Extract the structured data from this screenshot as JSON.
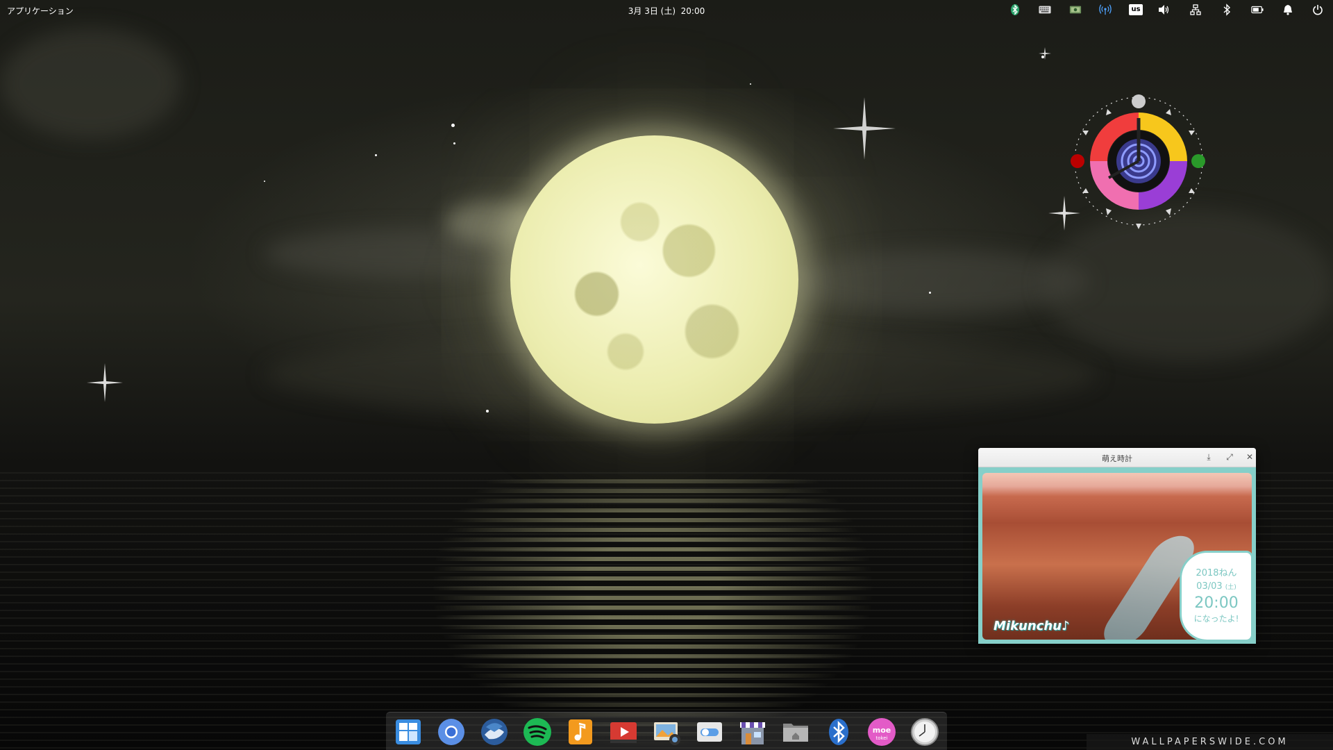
{
  "top_panel": {
    "apps_label": "アプリケーション",
    "date": "3月 3日 (土)",
    "time": "20:00",
    "tray": {
      "keyboard_layout": "us"
    }
  },
  "moe_window": {
    "title": "萌え時計",
    "year": "2018ねん",
    "date": "03/03",
    "weekday": "(土)",
    "time": "20:00",
    "message": "になったよ!",
    "brand": "Mikunchu♪"
  },
  "dock": {
    "items": [
      "multitasking-view",
      "chromium",
      "thunderbird",
      "spotify",
      "music",
      "videos",
      "photos",
      "system-settings",
      "appcenter",
      "files",
      "bluetooth",
      "moe-tokei",
      "clock"
    ]
  },
  "watermark": "WALLPAPERSWIDE.COM",
  "colors": {
    "moon": "#ecedb0",
    "moe_accent": "#86cfc9",
    "spotify": "#1db954"
  }
}
